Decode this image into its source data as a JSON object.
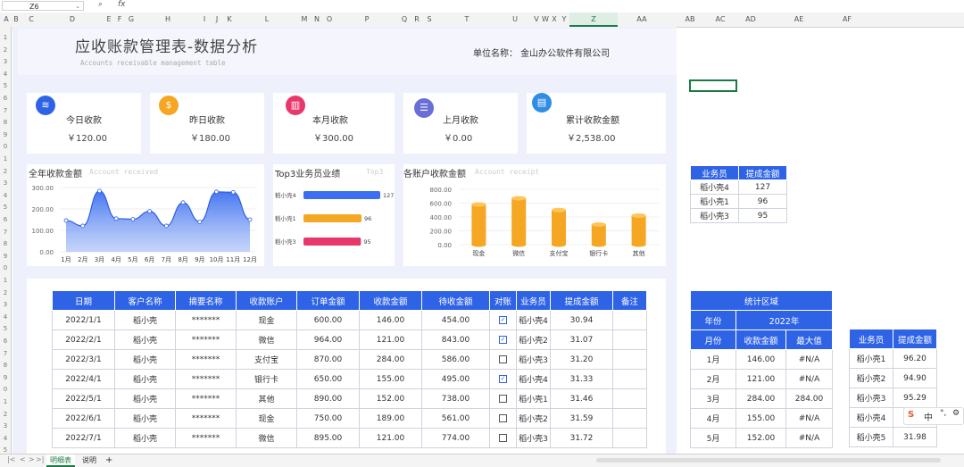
{
  "formula_bar": {
    "name_box": "Z6",
    "zoom_icon": "magnifier-icon",
    "fx": "fx"
  },
  "columns": [
    "A",
    "B",
    "C",
    "D",
    "E",
    "F",
    "G",
    "H",
    "I",
    "J",
    "K",
    "L",
    "M",
    "N",
    "O",
    "P",
    "Q",
    "R",
    "S",
    "T",
    "U",
    "V",
    "W",
    "X",
    "Y",
    "Z",
    "AA",
    "AB",
    "AC",
    "AD",
    "AE",
    "AF"
  ],
  "selected_column": "Z",
  "rows": [
    "1",
    "2",
    "3",
    "4",
    "5",
    "6",
    "7",
    "8",
    "9",
    "0",
    "1",
    "2",
    "3",
    "4",
    "5",
    "6",
    "7",
    "8",
    "9",
    "0",
    "1",
    "2",
    "3",
    "4",
    "5",
    "6",
    "7",
    "8",
    "9",
    "0",
    "1",
    "2",
    "3",
    "4",
    "5"
  ],
  "dashboard": {
    "title": "应收账款管理表-数据分析",
    "subtitle": "Accounts receivable management table",
    "unit_label": "单位名称：  金山办公软件有限公司",
    "cards": [
      {
        "label": "今日收款",
        "value": "￥120.00",
        "icon": "layers-icon",
        "color": "#2f63e6"
      },
      {
        "label": "昨日收款",
        "value": "￥180.00",
        "icon": "money-bag-icon",
        "color": "#f5a623"
      },
      {
        "label": "本月收款",
        "value": "￥300.00",
        "icon": "bar-chart-icon",
        "color": "#e8386b"
      },
      {
        "label": "上月收款",
        "value": "￥0.00",
        "icon": "stack-icon",
        "color": "#6a6fd6"
      },
      {
        "label": "累计收款金额",
        "value": "￥2,538.00",
        "icon": "report-icon",
        "color": "#2f8de6"
      }
    ],
    "panels": {
      "annual": {
        "title": "全年收款金额",
        "subtitle": "Account received"
      },
      "top3": {
        "title": "Top3业务员业绩",
        "subtitle": "Top3"
      },
      "accounts": {
        "title": "各账户收款金额",
        "subtitle": "Account receipt"
      }
    }
  },
  "chart_data": [
    {
      "type": "area",
      "title": "全年收款金额",
      "categories": [
        "1月",
        "2月",
        "3月",
        "4月",
        "5月",
        "6月",
        "7月",
        "8月",
        "9月",
        "10月",
        "11月",
        "12月"
      ],
      "values": [
        146,
        121,
        284,
        155,
        152,
        189,
        121,
        230,
        140,
        280,
        278,
        150
      ],
      "ylim": [
        0,
        300
      ],
      "yticks": [
        "0.00",
        "100.00",
        "200.00",
        "300.00"
      ],
      "color": "#3a6ff0"
    },
    {
      "type": "bar",
      "orientation": "horizontal",
      "title": "Top3业务员业绩",
      "categories": [
        "稻小壳4",
        "稻小壳1",
        "稻小壳3"
      ],
      "values": [
        127,
        96,
        95
      ],
      "colors": [
        "#3a6ff0",
        "#f5a623",
        "#e8386b"
      ],
      "xlim": [
        0,
        127
      ]
    },
    {
      "type": "bar",
      "title": "各账户收款金额",
      "categories": [
        "现金",
        "微信",
        "支付宝",
        "银行卡",
        "其他"
      ],
      "values": [
        580,
        670,
        500,
        290,
        420
      ],
      "ylim": [
        0,
        800
      ],
      "yticks": [
        "0.00",
        "200.00",
        "400.00",
        "600.00",
        "800.00"
      ],
      "color": "#f5a623"
    }
  ],
  "main_table": {
    "headers": [
      "日期",
      "客户名称",
      "摘要名称",
      "收款账户",
      "订单金额",
      "收款金额",
      "待收金额",
      "对账",
      "业务员",
      "提成金额",
      "备注"
    ],
    "rows": [
      [
        "2022/1/1",
        "稻小壳",
        "*******",
        "现金",
        "600.00",
        "146.00",
        "454.00",
        true,
        "稻小壳4",
        "30.94",
        ""
      ],
      [
        "2022/2/1",
        "稻小壳",
        "*******",
        "微信",
        "964.00",
        "121.00",
        "843.00",
        true,
        "稻小壳2",
        "31.07",
        ""
      ],
      [
        "2022/3/1",
        "稻小壳",
        "*******",
        "支付宝",
        "870.00",
        "284.00",
        "586.00",
        false,
        "稻小壳3",
        "31.20",
        ""
      ],
      [
        "2022/4/1",
        "稻小壳",
        "*******",
        "银行卡",
        "650.00",
        "155.00",
        "495.00",
        true,
        "稻小壳4",
        "31.33",
        ""
      ],
      [
        "2022/5/1",
        "稻小壳",
        "*******",
        "其他",
        "890.00",
        "152.00",
        "738.00",
        false,
        "稻小壳1",
        "31.46",
        ""
      ],
      [
        "2022/6/1",
        "稻小壳",
        "*******",
        "现金",
        "750.00",
        "189.00",
        "561.00",
        false,
        "稻小壳2",
        "31.59",
        ""
      ],
      [
        "2022/7/1",
        "稻小壳",
        "*******",
        "微信",
        "895.00",
        "121.00",
        "774.00",
        false,
        "稻小壳3",
        "31.72",
        ""
      ]
    ]
  },
  "top3_table": {
    "headers": [
      "业务员",
      "提成金额"
    ],
    "rows": [
      [
        "稻小壳4",
        "127"
      ],
      [
        "稻小壳1",
        "96"
      ],
      [
        "稻小壳3",
        "95"
      ]
    ]
  },
  "stats_table": {
    "title": "统计区域",
    "year_label": "年份",
    "year_value": "2022年",
    "headers": [
      "月份",
      "收款金额",
      "最大值"
    ],
    "rows": [
      [
        "1月",
        "146.00",
        "#N/A"
      ],
      [
        "2月",
        "121.00",
        "#N/A"
      ],
      [
        "3月",
        "284.00",
        "284.00"
      ],
      [
        "4月",
        "155.00",
        "#N/A"
      ],
      [
        "5月",
        "152.00",
        "#N/A"
      ]
    ]
  },
  "commission_table": {
    "headers": [
      "业务员",
      "提成金额"
    ],
    "rows": [
      [
        "稻小壳1",
        "96.20"
      ],
      [
        "稻小壳2",
        "94.90"
      ],
      [
        "稻小壳3",
        "95.29"
      ],
      [
        "稻小壳4",
        "1"
      ],
      [
        "稻小壳5",
        "31.98"
      ]
    ]
  },
  "sheet_tabs": {
    "active": "明细表",
    "other": "说明",
    "add": "+"
  },
  "ime": {
    "brand": "S",
    "mode": "中"
  }
}
